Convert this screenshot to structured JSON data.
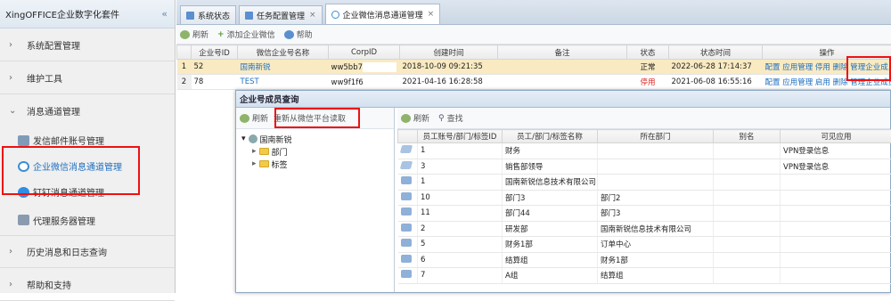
{
  "sidebar": {
    "title": "XingOFFICE企业数字化套件",
    "collapse": "«",
    "groups": [
      {
        "label": "系统配置管理"
      },
      {
        "label": "维护工具"
      },
      {
        "label": "消息通道管理"
      }
    ],
    "subs": [
      {
        "label": "发信邮件账号管理"
      },
      {
        "label": "企业微信消息通道管理"
      },
      {
        "label": "钉钉消息通道管理"
      },
      {
        "label": "代理服务器管理"
      }
    ],
    "groups2": [
      {
        "label": "历史消息和日志查询"
      },
      {
        "label": "帮助和支持"
      }
    ]
  },
  "tabs": [
    {
      "label": "系统状态"
    },
    {
      "label": "任务配置管理",
      "close": "×"
    },
    {
      "label": "企业微信消息通道管理",
      "close": "×"
    }
  ],
  "toolbar": {
    "refresh": "刷新",
    "add": "添加企业微信",
    "help": "帮助"
  },
  "grid": {
    "headers": [
      "企业号ID",
      "微信企业号名称",
      "CorpID",
      "创建时间",
      "备注",
      "状态",
      "状态时间",
      "操作"
    ],
    "rows": [
      {
        "n": "1",
        "id": "52",
        "name": "国南新锐",
        "corp": "ww5bb7",
        "created": "2018-10-09 09:21:35",
        "note": "",
        "status": "正常",
        "stime": "2022-06-28 17:14:37",
        "ops": "配置 应用管理 停用 删除 管理企业成员"
      },
      {
        "n": "2",
        "id": "78",
        "name": "TEST",
        "corp": "ww9f1f6",
        "created": "2021-04-16 16:28:58",
        "note": "",
        "status": "停用",
        "stime": "2021-06-08 16:55:16",
        "ops": "配置 应用管理 启用 删除 管理企业成员"
      }
    ]
  },
  "dialog": {
    "title": "企业号成员查询",
    "left_refresh": "刷新",
    "reload": "重新从微信平台读取",
    "right_refresh": "刷新",
    "find": "查找",
    "tree": {
      "root": "国南新锐",
      "children": [
        "部门",
        "标签"
      ]
    },
    "headers": [
      "员工账号/部门/标签ID",
      "员工/部门/标签名称",
      "所在部门",
      "别名",
      "可见应用"
    ],
    "rows": [
      {
        "id": "1",
        "name": "财务",
        "dept": "",
        "alias": "",
        "app": "VPN登录信息",
        "kind": "tag"
      },
      {
        "id": "3",
        "name": "销售部领导",
        "dept": "",
        "alias": "",
        "app": "VPN登录信息",
        "kind": "tag"
      },
      {
        "id": "1",
        "name": "国南新锐信息技术有限公司",
        "dept": "",
        "alias": "",
        "app": "",
        "kind": "dept"
      },
      {
        "id": "10",
        "name": "部门3",
        "dept": "部门2",
        "alias": "",
        "app": "",
        "kind": "dept"
      },
      {
        "id": "11",
        "name": "部门44",
        "dept": "部门3",
        "alias": "",
        "app": "",
        "kind": "dept"
      },
      {
        "id": "2",
        "name": "研发部",
        "dept": "国南新锐信息技术有限公司",
        "alias": "",
        "app": "",
        "kind": "dept"
      },
      {
        "id": "5",
        "name": "财务1部",
        "dept": "订单中心",
        "alias": "",
        "app": "",
        "kind": "dept"
      },
      {
        "id": "6",
        "name": "结算组",
        "dept": "财务1部",
        "alias": "",
        "app": "",
        "kind": "dept"
      },
      {
        "id": "7",
        "name": "A组",
        "dept": "结算组",
        "alias": "",
        "app": "",
        "kind": "dept"
      }
    ]
  }
}
